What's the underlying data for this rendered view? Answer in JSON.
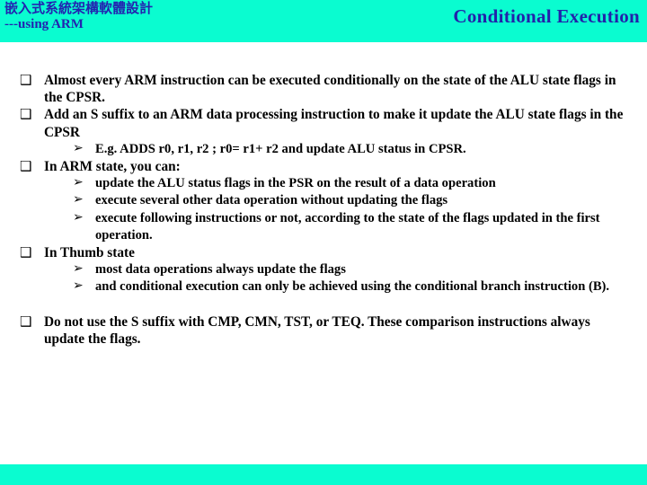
{
  "header": {
    "brand_cn": "嵌入式系統架構軟體設計",
    "brand_sub": "---using ARM",
    "title": "Conditional Execution",
    "band_color": "#0afcd0",
    "title_color": "#2222aa"
  },
  "footer": {
    "band_color": "#0afcd0"
  },
  "bullets": {
    "square_glyph": "❑",
    "arrow_glyph": "➢"
  },
  "content": [
    {
      "text": "Almost every ARM instruction can be executed conditionally on the state of the ALU state flags in the CPSR.",
      "children": []
    },
    {
      "text": "Add an S suffix to an ARM data processing instruction to make it update the ALU state flags in the CPSR",
      "children": [
        "E.g. ADDS  r0, r1, r2 ; r0= r1+ r2 and update ALU status in CPSR."
      ]
    },
    {
      "text": "In ARM state, you can:",
      "children": [
        "update the ALU status flags in the PSR on the result of a data operation",
        "execute several other data operation without updating the flags",
        "execute following instructions or not, according to the state of the flags updated in the first operation."
      ]
    },
    {
      "text": "In Thumb state",
      "children": [
        "most data operations always update the flags",
        "and conditional execution can only be achieved using the conditional branch instruction (B)."
      ]
    },
    {
      "text": "Do not use the S suffix with CMP, CMN, TST, or TEQ. These comparison instructions always update the flags.",
      "children": [],
      "spaced": true
    }
  ]
}
